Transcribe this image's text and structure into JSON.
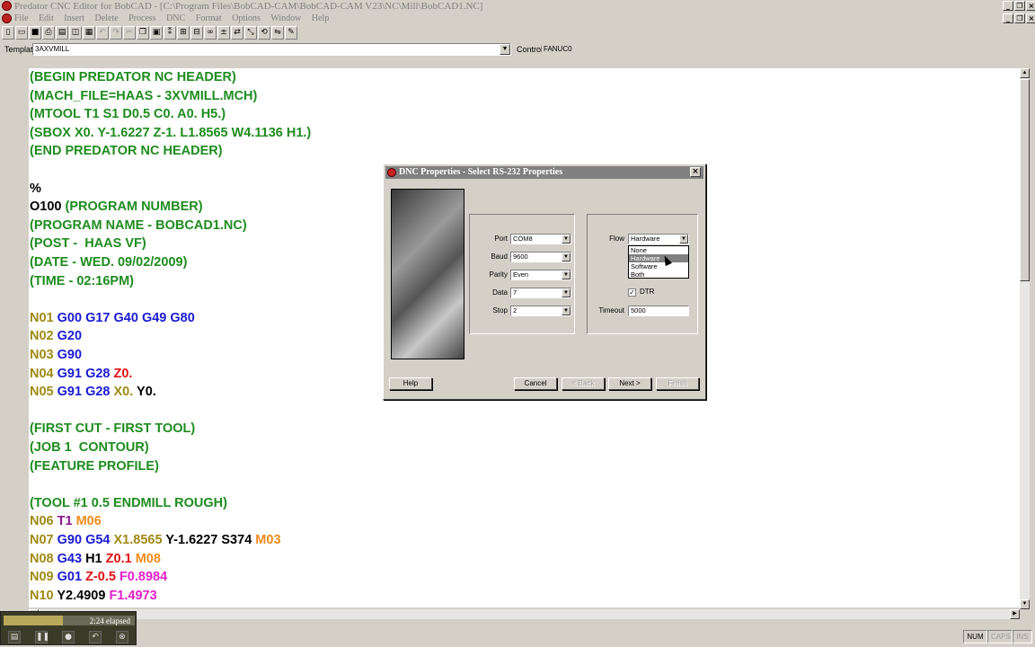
{
  "window": {
    "title": "Predator CNC Editor for BobCAD - [C:\\Program Files\\BobCAD-CAM\\BobCAD-CAM V23\\NC\\Mill\\BobCAD1.NC]"
  },
  "menu": [
    "File",
    "Edit",
    "Insert",
    "Delete",
    "Process",
    "DNC",
    "Format",
    "Options",
    "Window",
    "Help"
  ],
  "template_bar": {
    "template_label": "Template",
    "template_value": "3AXVMILL",
    "control_label": "Control",
    "control_value": "FANUC0"
  },
  "editor": {
    "colors": {
      "green": "#1e8c1e",
      "olive": "#a08a14",
      "blue": "#1a1ad2",
      "black": "#000000",
      "red": "#e01010",
      "orange": "#f08a1a",
      "purple": "#8a1a8a",
      "magenta": "#e020c8"
    },
    "lines": [
      [
        {
          "t": "(BEGIN PREDATOR NC HEADER)",
          "c": "green"
        }
      ],
      [
        {
          "t": "(MACH_FILE=HAAS - 3XVMILL.MCH)",
          "c": "green"
        }
      ],
      [
        {
          "t": "(MTOOL T1 S1 D0.5 C0. A0. H5.)",
          "c": "green"
        }
      ],
      [
        {
          "t": "(SBOX X0. Y-1.6227 Z-1. L1.8565 W4.1136 H1.)",
          "c": "green"
        }
      ],
      [
        {
          "t": "(END PREDATOR NC HEADER)",
          "c": "green"
        }
      ],
      [],
      [
        {
          "t": "%",
          "c": "black"
        }
      ],
      [
        {
          "t": "O100 ",
          "c": "black"
        },
        {
          "t": "(PROGRAM NUMBER)",
          "c": "green"
        }
      ],
      [
        {
          "t": "(PROGRAM NAME - BOBCAD1.NC)",
          "c": "green"
        }
      ],
      [
        {
          "t": "(POST -  HAAS VF)",
          "c": "green"
        }
      ],
      [
        {
          "t": "(DATE - WED. 09/02/2009)",
          "c": "green"
        }
      ],
      [
        {
          "t": "(TIME - 02:16PM)",
          "c": "green"
        }
      ],
      [],
      [
        {
          "t": "N01 ",
          "c": "olive"
        },
        {
          "t": "G00 G17 G40 G49 G80",
          "c": "blue"
        }
      ],
      [
        {
          "t": "N02 ",
          "c": "olive"
        },
        {
          "t": "G20",
          "c": "blue"
        }
      ],
      [
        {
          "t": "N03 ",
          "c": "olive"
        },
        {
          "t": "G90",
          "c": "blue"
        }
      ],
      [
        {
          "t": "N04 ",
          "c": "olive"
        },
        {
          "t": "G91 G28 ",
          "c": "blue"
        },
        {
          "t": "Z0.",
          "c": "red"
        }
      ],
      [
        {
          "t": "N05 ",
          "c": "olive"
        },
        {
          "t": "G91 G28 ",
          "c": "blue"
        },
        {
          "t": "X0. ",
          "c": "olive"
        },
        {
          "t": "Y0.",
          "c": "black"
        }
      ],
      [],
      [
        {
          "t": "(FIRST CUT - FIRST TOOL)",
          "c": "green"
        }
      ],
      [
        {
          "t": "(JOB 1  CONTOUR)",
          "c": "green"
        }
      ],
      [
        {
          "t": "(FEATURE PROFILE)",
          "c": "green"
        }
      ],
      [],
      [
        {
          "t": "(TOOL #1 0.5 ENDMILL ROUGH)",
          "c": "green"
        }
      ],
      [
        {
          "t": "N06 ",
          "c": "olive"
        },
        {
          "t": "T1 ",
          "c": "purple"
        },
        {
          "t": "M06",
          "c": "orange"
        }
      ],
      [
        {
          "t": "N07 ",
          "c": "olive"
        },
        {
          "t": "G90 G54 ",
          "c": "blue"
        },
        {
          "t": "X1.8565 ",
          "c": "olive"
        },
        {
          "t": "Y-1.6227 S374 ",
          "c": "black"
        },
        {
          "t": "M03",
          "c": "orange"
        }
      ],
      [
        {
          "t": "N08 ",
          "c": "olive"
        },
        {
          "t": "G43 ",
          "c": "blue"
        },
        {
          "t": "H1 ",
          "c": "black"
        },
        {
          "t": "Z0.1 ",
          "c": "red"
        },
        {
          "t": "M08",
          "c": "orange"
        }
      ],
      [
        {
          "t": "N09 ",
          "c": "olive"
        },
        {
          "t": "G01 ",
          "c": "blue"
        },
        {
          "t": "Z-0.5 ",
          "c": "red"
        },
        {
          "t": "F0.8984",
          "c": "magenta"
        }
      ],
      [
        {
          "t": "N10 ",
          "c": "olive"
        },
        {
          "t": "Y2.4909 ",
          "c": "black"
        },
        {
          "t": "F1.4973",
          "c": "magenta"
        }
      ]
    ]
  },
  "dialog": {
    "title": "DNC Properties - Select RS-232 Properties",
    "port": {
      "label": "Port",
      "value": "COM8"
    },
    "baud": {
      "label": "Baud",
      "value": "9600"
    },
    "parity": {
      "label": "Parity",
      "value": "Even"
    },
    "data": {
      "label": "Data",
      "value": "7"
    },
    "stop": {
      "label": "Stop",
      "value": "2"
    },
    "flow": {
      "label": "Flow",
      "value": "Hardware",
      "options": [
        "None",
        "Hardware",
        "Software",
        "Both"
      ],
      "selected_index": 1
    },
    "dtr": {
      "label": "DTR",
      "checked": true
    },
    "timeout": {
      "label": "Timeout",
      "value": "5000"
    },
    "buttons": {
      "help": "Help",
      "cancel": "Cancel",
      "back": "< Back",
      "next": "Next >",
      "finish": "Finish"
    }
  },
  "recorder": {
    "elapsed": "2:24 elapsed",
    "progress": 0.45
  },
  "status": {
    "num": "NUM",
    "caps": "CAPS",
    "ins": "INS"
  }
}
